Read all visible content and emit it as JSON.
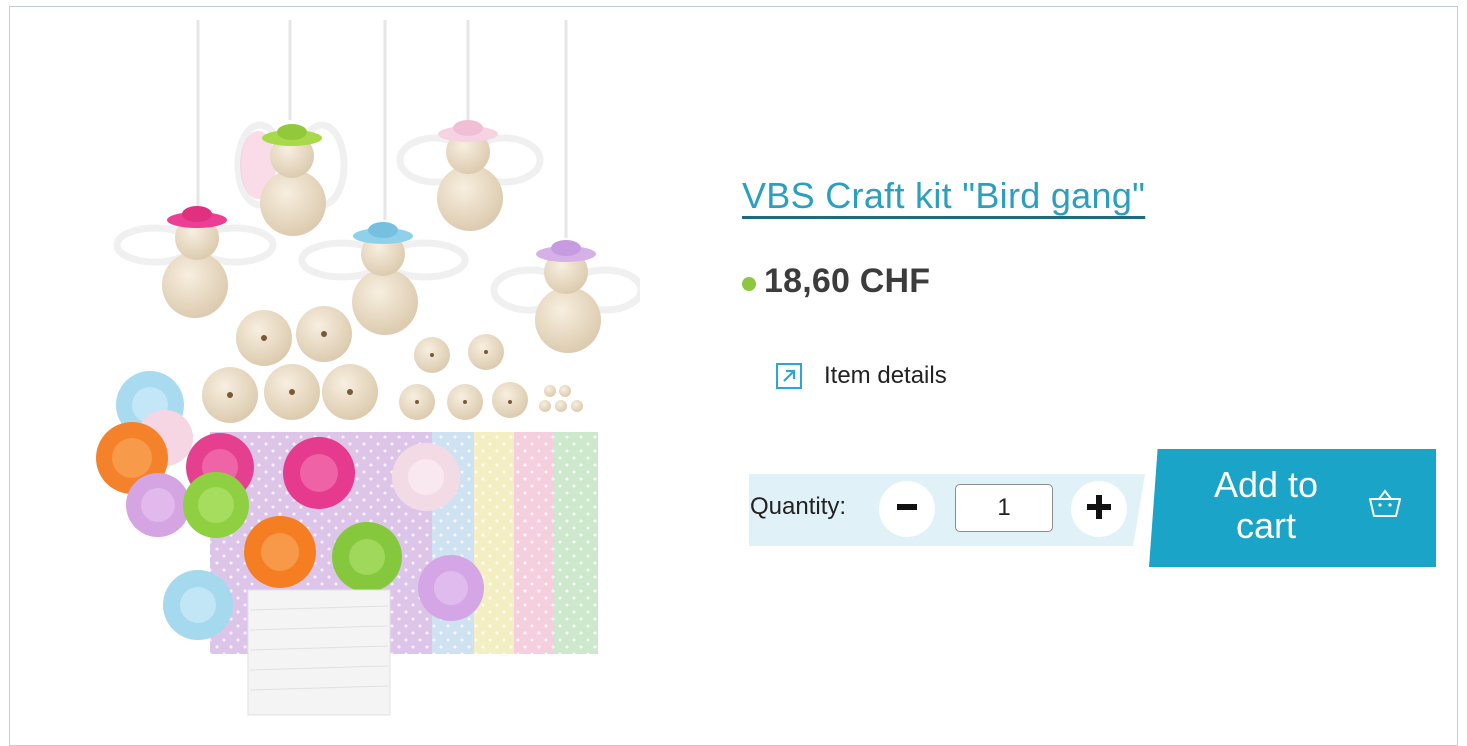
{
  "product": {
    "title": "VBS Craft kit \"Bird gang\"",
    "price": "18,60 CHF",
    "availability_color": "#8dc63f",
    "image_icon": "product-photo-bird-craft-kit"
  },
  "details": {
    "label": "Item details",
    "icon": "external-link-icon"
  },
  "quantity": {
    "label": "Quantity:",
    "value": "1",
    "decrease_icon": "minus-icon",
    "increase_icon": "plus-icon"
  },
  "cart": {
    "button_line1": "Add to",
    "button_line2": "cart",
    "icon": "basket-icon",
    "button_color": "#1aa4c8"
  },
  "colors": {
    "link": "#2a9fbf",
    "accent": "#2aa7d3",
    "quantity_bg": "#e0f1f8"
  }
}
